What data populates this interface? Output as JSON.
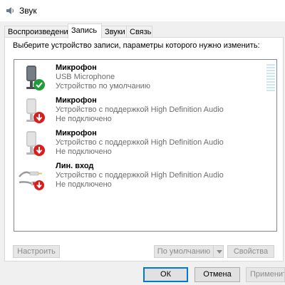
{
  "window": {
    "title": "Звук",
    "app_icon": "speaker-icon"
  },
  "tabs": [
    {
      "label": "Воспроизведение",
      "active": false
    },
    {
      "label": "Запись",
      "active": true
    },
    {
      "label": "Звуки",
      "active": false
    },
    {
      "label": "Связь",
      "active": false
    }
  ],
  "instruction": "Выберите устройство записи, параметры которого нужно изменить:",
  "devices": [
    {
      "name": "Микрофон",
      "description": "USB Microphone",
      "status": "Устройство по умолчанию",
      "icon": "microphone-icon",
      "badge": "green-check-icon",
      "has_level_meter": true
    },
    {
      "name": "Микрофон",
      "description": "Устройство с поддержкой High Definition Audio",
      "status": "Не подключено",
      "icon": "microphone-icon",
      "badge": "red-down-arrow-icon",
      "has_level_meter": false
    },
    {
      "name": "Микрофон",
      "description": "Устройство с поддержкой High Definition Audio",
      "status": "Не подключено",
      "icon": "microphone-icon",
      "badge": "red-down-arrow-icon",
      "has_level_meter": false
    },
    {
      "name": "Лин. вход",
      "description": "Устройство с поддержкой High Definition Audio",
      "status": "Не подключено",
      "icon": "line-in-cable-icon",
      "badge": "red-down-arrow-icon",
      "has_level_meter": false
    }
  ],
  "panel_buttons": {
    "configure": "Настроить",
    "set_default": "По умолчанию",
    "properties": "Свойства"
  },
  "dialog_buttons": {
    "ok": "ОК",
    "cancel": "Отмена",
    "apply": "Применить"
  },
  "colors": {
    "accent": "#0078d7",
    "check_green": "#1e9e3a",
    "arrow_red": "#d81e1e",
    "meter_empty": "#cde7ef"
  }
}
